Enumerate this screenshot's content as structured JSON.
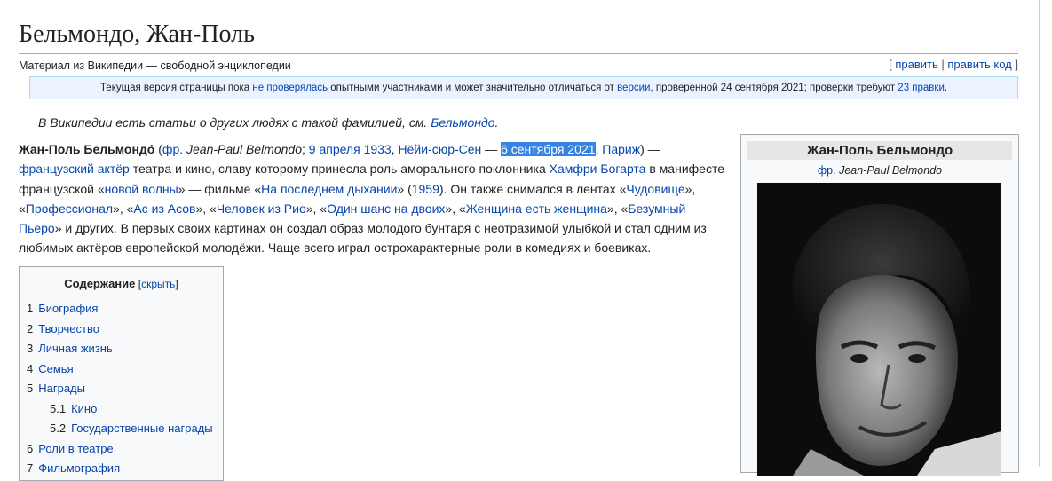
{
  "title": "Бельмондо, Жан-Поль",
  "site_sub": "Материал из Википедии — свободной энциклопедии",
  "edit": {
    "open": "[",
    "edit": "править",
    "sep": "|",
    "edit_code": "править код",
    "close": "]"
  },
  "flagged": {
    "t1": "Текущая версия страницы пока ",
    "l1": "не проверялась",
    "t2": " опытными участниками и может значительно отличаться от ",
    "l2": "версии",
    "t3": ", проверенной 24 сентября 2021; проверки требуют ",
    "l3": "23 правки",
    "t4": "."
  },
  "hatnote": {
    "text": "В Википедии есть статьи о других людях с такой фамилией, см. ",
    "link": "Бельмондо",
    "end": "."
  },
  "lead": {
    "name": "Жан-Поль Бельмондо́",
    "p1": " (",
    "fr": "фр.",
    "fr_name": " Jean-Paul Belmondo",
    "p2": "; ",
    "birth": "9 апреля 1933",
    "p3": ", ",
    "birthplace": "Нёйи-сюр-Сен",
    "p4": " — ",
    "death": "6 сентября 2021",
    "p5": ", ",
    "deathplace": "Париж",
    "p6": ") —",
    "actor": "французский актёр",
    "t1": " театра и кино, славу которому принесла роль аморального поклонника ",
    "bogart": "Хамфри Богарта",
    "t2": " в манифесте французской «",
    "nw": "новой волны",
    "t3": "» — фильме «",
    "breathless": "На последнем дыхании",
    "t4": "» (",
    "y1959": "1959",
    "t5": "). Он также снимался в лентах «",
    "m1": "Чудовище",
    "t6": "», «",
    "m2": "Профессионал",
    "t7": "», «",
    "m3": "Ас из Асов",
    "t8": "», «",
    "m4": "Человек из Рио",
    "t9": "», «",
    "m5": "Один шанс на двоих",
    "t10": "», «",
    "m6": "Женщина есть женщина",
    "t11": "», «",
    "m7": "Безумный Пьеро",
    "t12": "» и других. В первых своих картинах он создал образ молодого бунтаря с неотразимой улыбкой и стал одним из любимых актёров европейской молодёжи. Чаще всего играл острохарактерные роли в комедиях и боевиках."
  },
  "toc": {
    "title": "Содержание",
    "hide_open": " [",
    "hide": "скрыть",
    "hide_close": "]",
    "items": [
      {
        "num": "1",
        "label": "Биография"
      },
      {
        "num": "2",
        "label": "Творчество"
      },
      {
        "num": "3",
        "label": "Личная жизнь"
      },
      {
        "num": "4",
        "label": "Семья"
      },
      {
        "num": "5",
        "label": "Награды"
      },
      {
        "num": "5.1",
        "label": "Кино"
      },
      {
        "num": "5.2",
        "label": "Государственные награды"
      },
      {
        "num": "6",
        "label": "Роли в театре"
      },
      {
        "num": "7",
        "label": "Фильмография"
      }
    ]
  },
  "infobox": {
    "title": "Жан-Поль Бельмондо",
    "fr": "фр.",
    "fr_name": " Jean-Paul Belmondo"
  }
}
